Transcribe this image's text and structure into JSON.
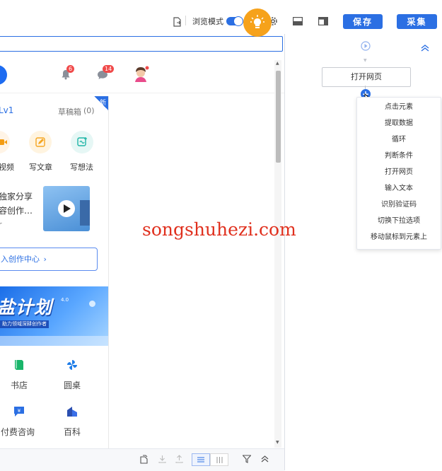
{
  "toolbar": {
    "browse_mode_label": "浏览模式",
    "save_label": "保存",
    "collect_label": "采集"
  },
  "webview": {
    "notification_count": "6",
    "message_count": "14",
    "level_label": "Lv1",
    "drafts_label": "草稿箱",
    "drafts_count": "(0)",
    "new_badge": "新",
    "shortcuts": [
      {
        "label": "视频"
      },
      {
        "label": "写文章"
      },
      {
        "label": "写想法"
      }
    ],
    "promo_line1": "独家分享",
    "promo_line2": "容创作…",
    "promo_line3": "r",
    "creator_center_label": "入创作中心",
    "banner_title": "盐计划",
    "banner_version": "4.0",
    "banner_subtitle": "助力领域深耕创作者",
    "services": [
      {
        "label": "书店"
      },
      {
        "label": "圆桌"
      },
      {
        "label": "付费咨询"
      },
      {
        "label": "百科"
      }
    ]
  },
  "panel": {
    "open_page_label": "打开网页",
    "menu_items": [
      "点击元素",
      "提取数据",
      "循环",
      "判断条件",
      "打开网页",
      "输入文本",
      "识别验证码",
      "切换下拉选项",
      "移动鼠标到元素上"
    ]
  },
  "watermark": "songshuhezi.com",
  "colors": {
    "primary": "#2b6fe3",
    "bulb": "#f6a21b",
    "badge": "#f04a4a",
    "watermark": "#e0301e"
  }
}
